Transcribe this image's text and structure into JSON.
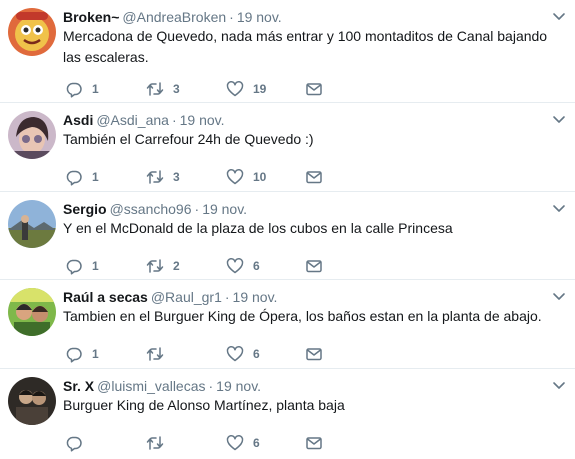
{
  "tweets": [
    {
      "name": "Broken~",
      "handle": "@AndreaBroken",
      "separator": "·",
      "time": "19 nov.",
      "text": "Mercadona de Quevedo, nada más entrar y 100 montaditos de Canal bajando las escaleras.",
      "replies": "1",
      "retweets": "3",
      "likes": "19",
      "avatar_color": "#d9523f"
    },
    {
      "name": "Asdi",
      "handle": "@Asdi_ana",
      "separator": "·",
      "time": "19 nov.",
      "text": "También el Carrefour 24h de Quevedo :)",
      "replies": "1",
      "retweets": "3",
      "likes": "10",
      "avatar_color": "#b9a3bd"
    },
    {
      "name": "Sergio",
      "handle": "@ssancho96",
      "separator": "·",
      "time": "19 nov.",
      "text": "Y en el McDonald de la plaza de los cubos en la calle Princesa",
      "replies": "1",
      "retweets": "2",
      "likes": "6",
      "avatar_color": "#6f8fb5"
    },
    {
      "name": "Raúl a secas",
      "handle": "@Raul_gr1",
      "separator": "·",
      "time": "19 nov.",
      "text": "Tambien en el Burguer King de Ópera, los baños estan en la planta de abajo.",
      "replies": "1",
      "retweets": "",
      "likes": "6",
      "avatar_color": "#8fbf4a"
    },
    {
      "name": "Sr. X",
      "handle": "@luismi_vallecas",
      "separator": "·",
      "time": "19 nov.",
      "text": "Burguer King de Alonso Martínez, planta baja",
      "replies": "",
      "retweets": "",
      "likes": "6",
      "avatar_color": "#3a3630"
    }
  ],
  "icons": {
    "reply": "reply-icon",
    "retweet": "retweet-icon",
    "like": "heart-icon",
    "dm": "direct-message-icon",
    "caret": "chevron-down-icon"
  },
  "colors": {
    "text": "#14171a",
    "secondary": "#657786",
    "divider": "#e6ecf0"
  }
}
